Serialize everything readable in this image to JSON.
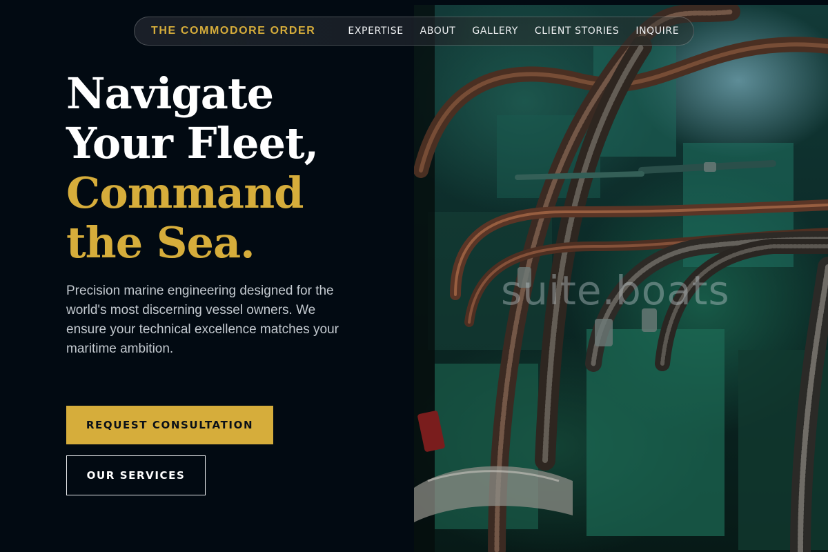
{
  "nav": {
    "brand": "THE COMMODORE ORDER",
    "links": [
      "EXPERTISE",
      "ABOUT",
      "GALLERY",
      "CLIENT STORIES",
      "INQUIRE"
    ]
  },
  "hero": {
    "headline_lines": [
      "Navigate",
      "Your Fleet,",
      "Command",
      "the Sea."
    ],
    "lead": "Precision marine engineering designed for the world's most discerning vessel owners. We ensure your technical excellence matches your maritime ambition.",
    "primary_cta": "REQUEST CONSULTATION",
    "secondary_cta": "OUR SERVICES",
    "image_watermark": "suite.boats"
  },
  "colors": {
    "background": "#020a12",
    "accent_gold": "#d6ad3b",
    "text_light": "#c4cad0"
  }
}
